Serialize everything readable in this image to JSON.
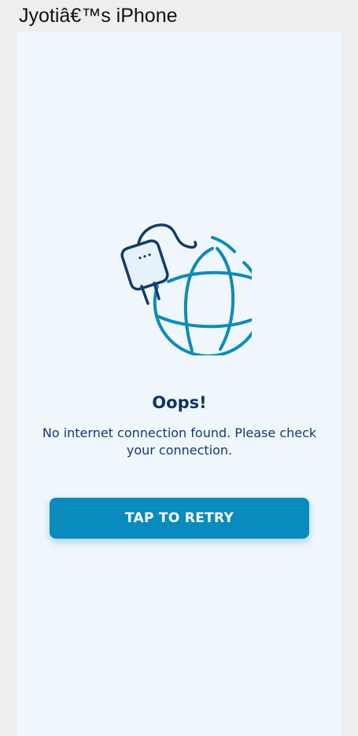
{
  "window": {
    "title": "Jyotiâ€™s iPhone"
  },
  "error_screen": {
    "illustration_icon": "unplugged-globe-icon",
    "title": "Oops!",
    "message": "No internet connection found. Please check your connection.",
    "retry_label": "TAP TO RETRY"
  },
  "colors": {
    "background": "#f0f7fc",
    "accent": "#0a8bbe",
    "title_text": "#0d3367",
    "plug_stroke": "#143a6b",
    "globe_stroke": "#0e8bb8"
  }
}
